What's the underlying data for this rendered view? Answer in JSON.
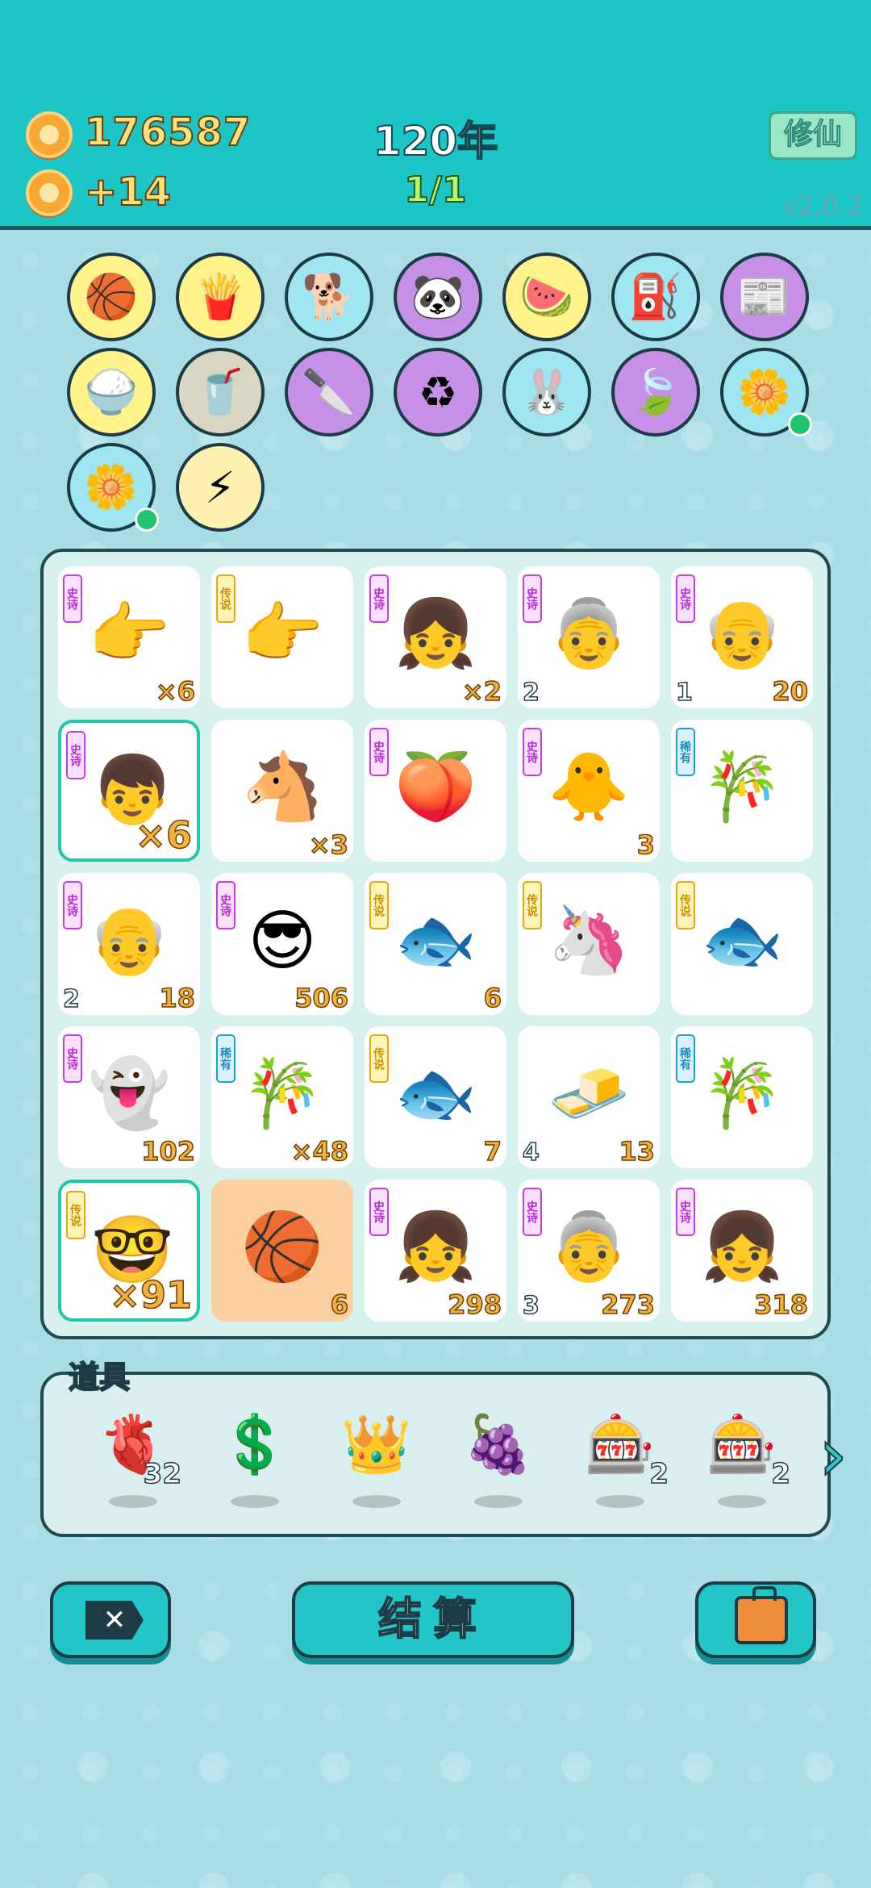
{
  "header": {
    "money": "176587",
    "income": "+14",
    "year": "120年",
    "progress": "1/1",
    "xiuxian_label": "修仙",
    "version": "v2.0.2"
  },
  "collection": [
    {
      "icon": "🏀",
      "name": "basketballs"
    },
    {
      "icon": "🍟",
      "name": "fries"
    },
    {
      "icon": "🐕",
      "name": "cool-dog"
    },
    {
      "icon": "🐼",
      "name": "panda"
    },
    {
      "icon": "🍉",
      "name": "fruit-basket"
    },
    {
      "icon": "⛽",
      "name": "pump"
    },
    {
      "icon": "📰",
      "name": "time-magazine"
    },
    {
      "icon": "🍚",
      "name": "rice-bowl"
    },
    {
      "icon": "🥤",
      "name": "bubble-tea"
    },
    {
      "icon": "🔪",
      "name": "cleaver"
    },
    {
      "icon": "♻",
      "name": "recycle"
    },
    {
      "icon": "🐰",
      "name": "rabbit"
    },
    {
      "icon": "🍃",
      "name": "leaf"
    },
    {
      "icon": "🌼",
      "name": "flower-pot"
    },
    {
      "icon": "🌼",
      "name": "flower-pot-2"
    },
    {
      "icon": "⚡",
      "name": "lightning"
    }
  ],
  "tags": {
    "epic": "史诗",
    "legend": "传说",
    "rare": "稀有"
  },
  "board": [
    {
      "tag": "epic",
      "icon": "👉",
      "name": "grey-hand",
      "count": "×6"
    },
    {
      "tag": "legend",
      "icon": "👉",
      "name": "gold-hand",
      "count": ""
    },
    {
      "tag": "epic",
      "icon": "👧",
      "name": "braid-girl",
      "count": "×2"
    },
    {
      "tag": "epic",
      "icon": "👵",
      "name": "heart-glasses-granny",
      "level": "2",
      "count": ""
    },
    {
      "tag": "epic",
      "icon": "👴",
      "name": "glasses-grandpa",
      "level": "1",
      "count": "20"
    },
    {
      "tag": "epic",
      "icon": "👦",
      "name": "red-cap-boy",
      "count": "×6"
    },
    {
      "tag": "",
      "icon": "🐴",
      "name": "horse",
      "count": "×3"
    },
    {
      "tag": "epic",
      "icon": "🍑",
      "name": "peach",
      "count": ""
    },
    {
      "tag": "epic",
      "icon": "🐥",
      "name": "chick-hair",
      "count": "3"
    },
    {
      "tag": "rare",
      "icon": "🎋",
      "name": "bamboo",
      "count": ""
    },
    {
      "tag": "epic",
      "icon": "👴",
      "name": "glasses-grandpa-2",
      "level": "2",
      "count": "18"
    },
    {
      "tag": "epic",
      "icon": "😎",
      "name": "green-hat-man",
      "count": "506"
    },
    {
      "tag": "legend",
      "icon": "🐟",
      "name": "koi-fish",
      "count": "6"
    },
    {
      "tag": "legend",
      "icon": "🦄",
      "name": "unicorn",
      "count": ""
    },
    {
      "tag": "legend",
      "icon": "🐟",
      "name": "koi-fish-2",
      "count": ""
    },
    {
      "tag": "epic",
      "icon": "👻",
      "name": "ghost",
      "count": "102"
    },
    {
      "tag": "rare",
      "icon": "🎋",
      "name": "bamboo-2",
      "count": "×48"
    },
    {
      "tag": "legend",
      "icon": "🐟",
      "name": "koi-fish-3",
      "count": "7"
    },
    {
      "tag": "",
      "icon": "🧈",
      "name": "gold-bars",
      "level": "4",
      "count": "13"
    },
    {
      "tag": "rare",
      "icon": "🎋",
      "name": "bamboo-3",
      "count": ""
    },
    {
      "tag": "legend",
      "icon": "🤓",
      "name": "gold-glasses-old-man",
      "count": "×91"
    },
    {
      "tag": "",
      "icon": "🏀",
      "name": "basketball-hand",
      "count": "6"
    },
    {
      "tag": "epic",
      "icon": "👧",
      "name": "braid-girl-2",
      "count": "298"
    },
    {
      "tag": "epic",
      "icon": "👵",
      "name": "heart-glasses-granny-2",
      "level": "3",
      "count": "273"
    },
    {
      "tag": "epic",
      "icon": "👧",
      "name": "braid-girl-3",
      "count": "318"
    }
  ],
  "props": {
    "label": "道具",
    "items": [
      {
        "icon": "🫀",
        "name": "liver",
        "count": "32"
      },
      {
        "icon": "💲",
        "name": "coin",
        "count": ""
      },
      {
        "icon": "👑",
        "name": "crown",
        "count": ""
      },
      {
        "icon": "🍇",
        "name": "bayberry",
        "count": ""
      },
      {
        "icon": "🎰",
        "name": "rare-slots",
        "count": "2"
      },
      {
        "icon": "🎰",
        "name": "epic-slots",
        "count": "2"
      }
    ]
  },
  "buttons": {
    "close": "✕",
    "settle": "结算"
  }
}
